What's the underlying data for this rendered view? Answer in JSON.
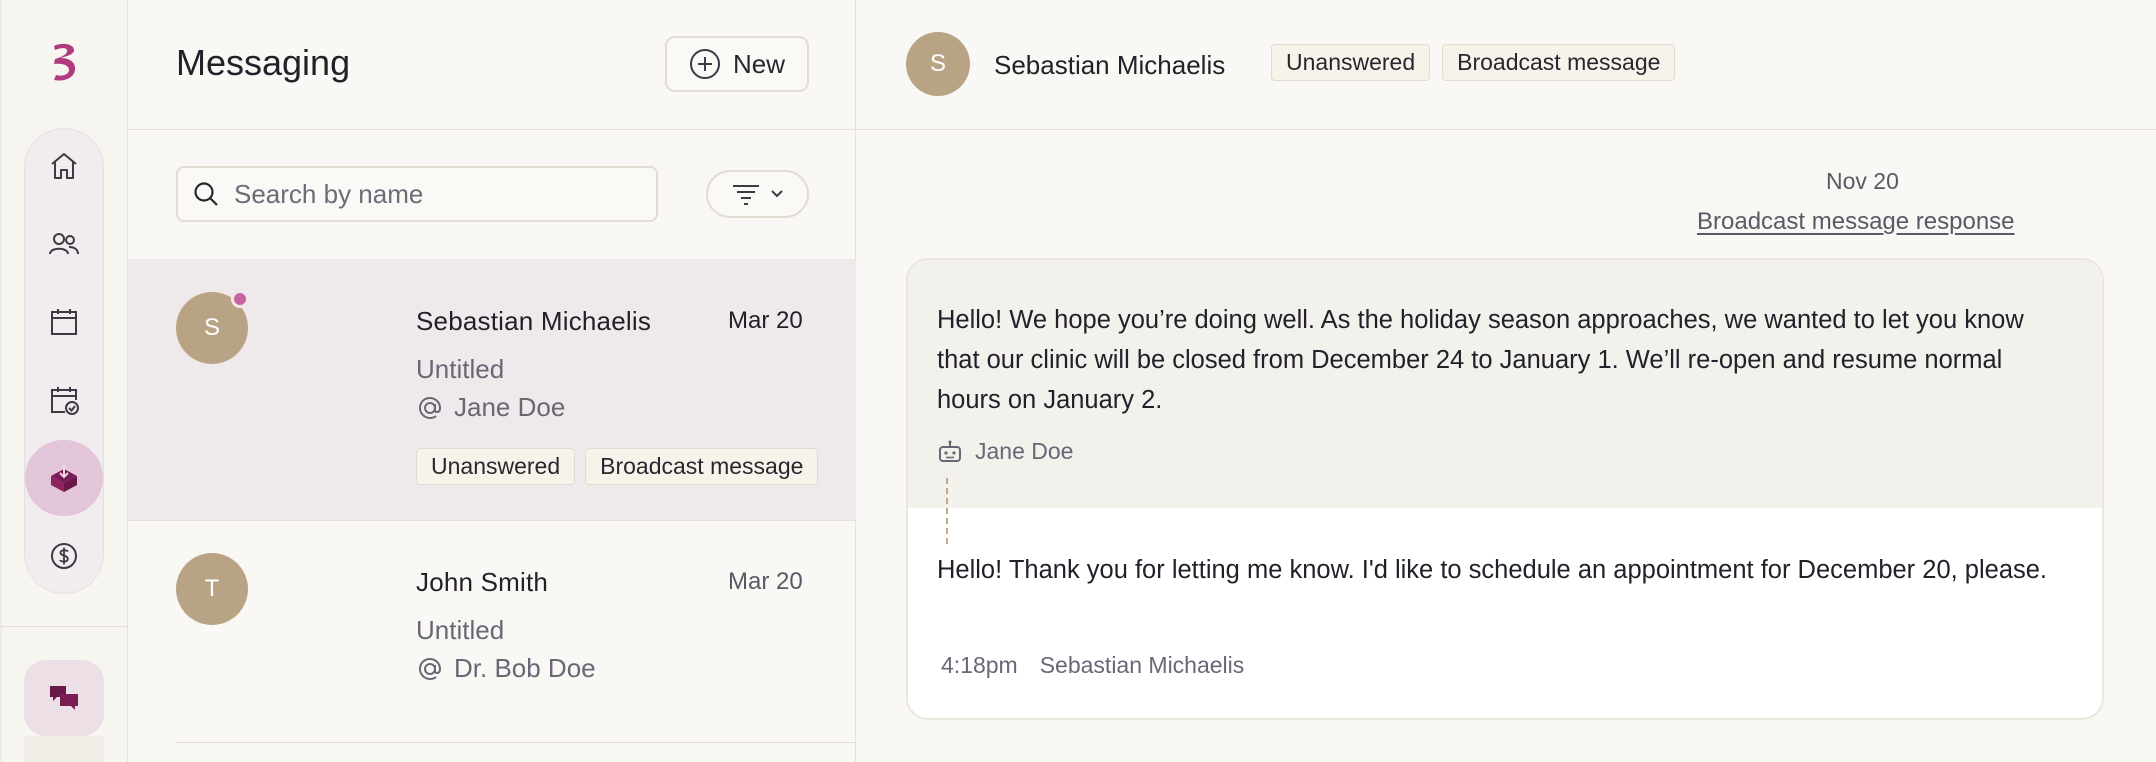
{
  "app": {
    "colors": {
      "accent": "#b23b7f",
      "avatar": "#b9a385",
      "selected_row": "#f0e9ec",
      "active_nav": "#e3c6da"
    }
  },
  "sidebar": {
    "logo_icon": "brand-logo-icon",
    "nav": [
      {
        "icon": "home-icon"
      },
      {
        "icon": "people-icon"
      },
      {
        "icon": "calendar-icon"
      },
      {
        "icon": "calendar-check-icon"
      },
      {
        "icon": "inbox-icon",
        "active": true
      },
      {
        "icon": "dollar-icon"
      }
    ],
    "chat_icon": "chat-bubbles-icon"
  },
  "list": {
    "title": "Messaging",
    "new_label": "New",
    "search_placeholder": "Search by name",
    "conversations": [
      {
        "initial": "S",
        "name": "Sebastian Michaelis",
        "date": "Mar 20",
        "subject": "Untitled",
        "assignee": "Jane Doe",
        "tags": [
          "Unanswered",
          "Broadcast message"
        ],
        "unread": true
      },
      {
        "initial": "T",
        "name": "John Smith",
        "date": "Mar 20",
        "subject": "Untitled",
        "assignee": "Dr. Bob Doe",
        "tags": []
      }
    ]
  },
  "conversation": {
    "initial": "S",
    "name": "Sebastian Michaelis",
    "tags": [
      "Unanswered",
      "Broadcast message"
    ],
    "day": "Nov 20",
    "broadcast_link": "Broadcast message response",
    "broadcast_text": "Hello! We hope you’re doing well. As the holiday season approaches, we wanted to let you know that our clinic will be closed from December 24 to January 1. We’ll re-open and resume normal hours on January 2.",
    "broadcast_sender": "Jane Doe",
    "reply_text": "Hello! Thank you for letting me know. I'd like to schedule an appointment for December 20, please.",
    "reply_time": "4:18pm",
    "reply_sender": "Sebastian Michaelis"
  }
}
